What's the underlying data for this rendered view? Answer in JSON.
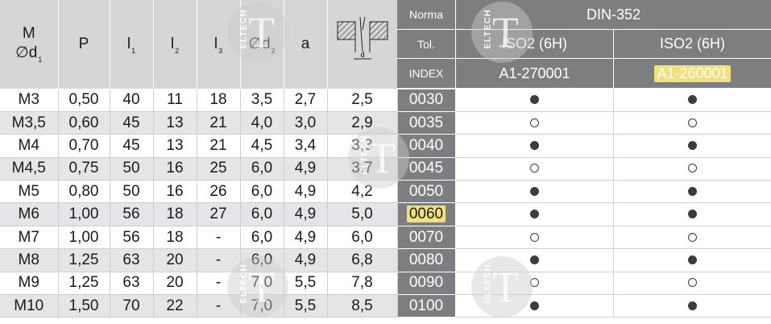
{
  "headers": {
    "m": "M",
    "d1_symbol": "∅d",
    "d1_sub": "1",
    "p": "P",
    "l1": "l",
    "l1_sub": "1",
    "l2": "l",
    "l2_sub": "2",
    "l3": "l",
    "l3_sub": "3",
    "d2": "∅d",
    "d2_sub": "2",
    "a": "a",
    "diagram_label": "d"
  },
  "right_header": {
    "norma_label": "Norma",
    "norma_value": "DIN-352",
    "tol_label": "Tol.",
    "tol_values": [
      "ISO2 (6H)",
      "ISO2 (6H)"
    ],
    "index_label": "INDEX",
    "index_values": [
      "A1-270001",
      "A1-260001"
    ]
  },
  "watermark_text": "ELTECH",
  "watermark_letter": "T",
  "rows": [
    {
      "m": "M3",
      "p": "0,50",
      "l1": "40",
      "l2": "11",
      "l3": "18",
      "d2": "3,5",
      "a": "2,7",
      "diag": "2,5",
      "idx": "0030",
      "c1": "filled",
      "c2": "filled"
    },
    {
      "m": "M3,5",
      "p": "0,60",
      "l1": "45",
      "l2": "13",
      "l3": "21",
      "d2": "4,0",
      "a": "3,0",
      "diag": "2,9",
      "idx": "0035",
      "c1": "empty",
      "c2": "empty"
    },
    {
      "m": "M4",
      "p": "0,70",
      "l1": "45",
      "l2": "13",
      "l3": "21",
      "d2": "4,5",
      "a": "3,4",
      "diag": "3,3",
      "idx": "0040",
      "c1": "filled",
      "c2": "filled"
    },
    {
      "m": "M4,5",
      "p": "0,75",
      "l1": "50",
      "l2": "16",
      "l3": "25",
      "d2": "6,0",
      "a": "4,9",
      "diag": "3,7",
      "idx": "0045",
      "c1": "empty",
      "c2": "empty"
    },
    {
      "m": "M5",
      "p": "0,80",
      "l1": "50",
      "l2": "16",
      "l3": "26",
      "d2": "6,0",
      "a": "4,9",
      "diag": "4,2",
      "idx": "0050",
      "c1": "filled",
      "c2": "filled"
    },
    {
      "m": "M6",
      "p": "1,00",
      "l1": "56",
      "l2": "18",
      "l3": "27",
      "d2": "6,0",
      "a": "4,9",
      "diag": "5,0",
      "idx": "0060",
      "c1": "filled",
      "c2": "filled"
    },
    {
      "m": "M7",
      "p": "1,00",
      "l1": "56",
      "l2": "18",
      "l3": "-",
      "d2": "6,0",
      "a": "4,9",
      "diag": "6,0",
      "idx": "0070",
      "c1": "empty",
      "c2": "empty"
    },
    {
      "m": "M8",
      "p": "1,25",
      "l1": "63",
      "l2": "20",
      "l3": "-",
      "d2": "6,0",
      "a": "4,9",
      "diag": "6,8",
      "idx": "0080",
      "c1": "filled",
      "c2": "filled"
    },
    {
      "m": "M9",
      "p": "1,25",
      "l1": "63",
      "l2": "20",
      "l3": "-",
      "d2": "7,0",
      "a": "5,5",
      "diag": "7,8",
      "idx": "0090",
      "c1": "empty",
      "c2": "empty"
    },
    {
      "m": "M10",
      "p": "1,50",
      "l1": "70",
      "l2": "22",
      "l3": "-",
      "d2": "7,0",
      "a": "5,5",
      "diag": "8,5",
      "idx": "0100",
      "c1": "filled",
      "c2": "filled"
    }
  ],
  "colors": {
    "header_bg": "#d5d6d8",
    "index_bg": "#7d7e80",
    "row_alt_bg": "#e4e5e6",
    "highlight": "#f2e07a"
  }
}
